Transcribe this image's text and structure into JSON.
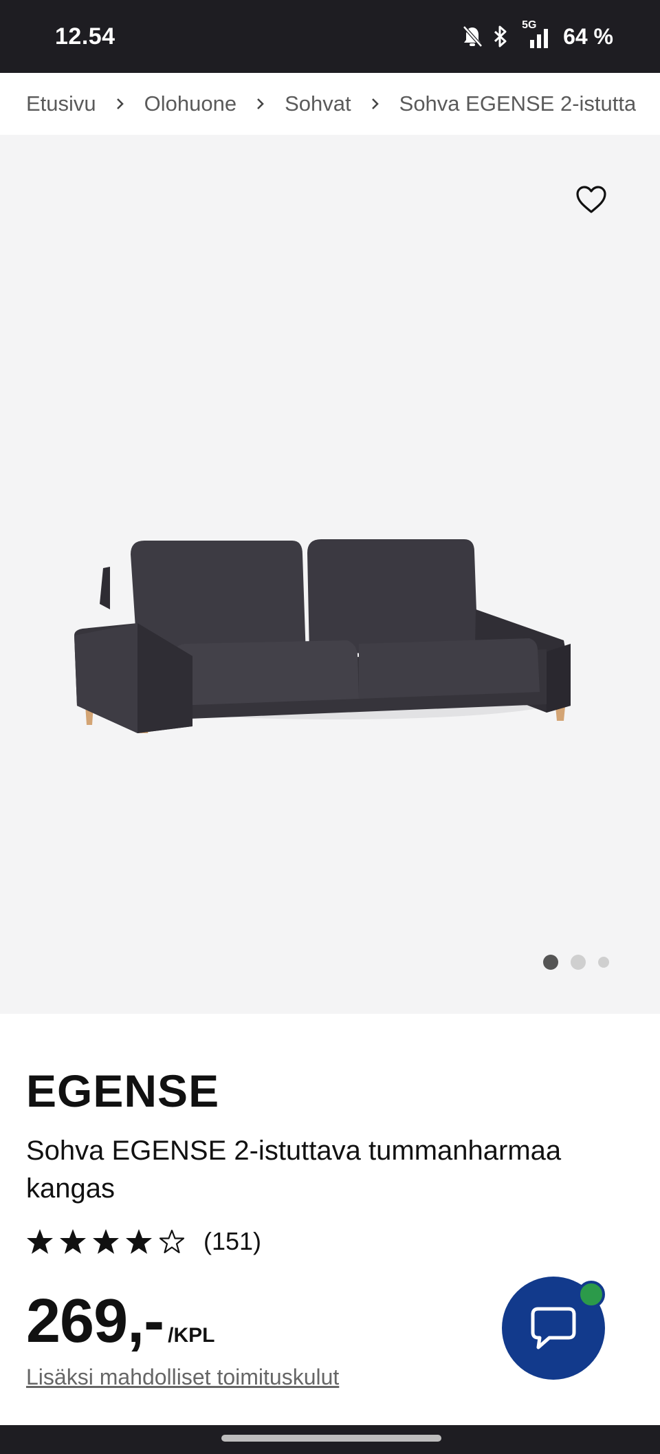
{
  "status_bar": {
    "time": "12.54",
    "network": "5G",
    "battery": "64 %",
    "icons": [
      "bell-muted-icon",
      "bluetooth-icon",
      "signal-icon"
    ]
  },
  "breadcrumb": {
    "items": [
      "Etusivu",
      "Olohuone",
      "Sohvat",
      "Sohva EGENSE 2-istutta"
    ]
  },
  "gallery": {
    "current_image": 1,
    "image_count": 3,
    "favorite_icon": "heart-icon"
  },
  "product": {
    "brand": "EGENSE",
    "description": "Sohva EGENSE 2-istuttava tummanharmaa kangas",
    "rating": 4,
    "rating_max": 5,
    "review_count": "(151)",
    "price": "269,-",
    "price_unit": "/KPL",
    "shipping_note": "Lisäksi mahdolliset toimituskulut"
  },
  "chat": {
    "icon": "chat-bubble-icon",
    "status": "online"
  },
  "colors": {
    "status_bar_bg": "#1e1d22",
    "gallery_bg": "#f4f4f5",
    "chat_button": "#123a8c",
    "online_indicator": "#2c9a4a",
    "sofa_fabric": "#3a3840",
    "sofa_legs": "#d0a070"
  }
}
